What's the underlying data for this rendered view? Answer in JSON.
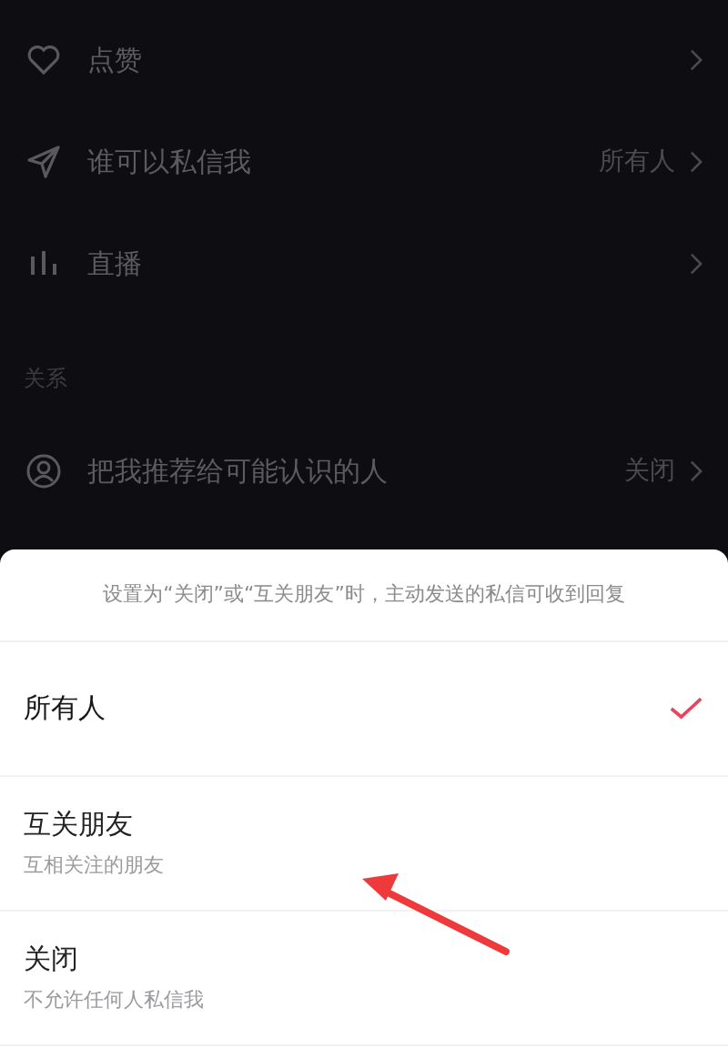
{
  "settings": [
    {
      "label": "点赞"
    },
    {
      "label": "谁可以私信我",
      "value": "所有人"
    },
    {
      "label": "直播"
    }
  ],
  "section": {
    "title": "关系",
    "items": [
      {
        "label": "把我推荐给可能认识的人",
        "value": "关闭"
      }
    ]
  },
  "sheet": {
    "hint": "设置为“关闭”或“互关朋友”时，主动发送的私信可收到回复",
    "options": [
      {
        "label": "所有人",
        "selected": true
      },
      {
        "label": "互关朋友",
        "description": "互相关注的朋友",
        "selected": false
      },
      {
        "label": "关闭",
        "description": "不允许任何人私信我",
        "selected": false
      }
    ]
  }
}
